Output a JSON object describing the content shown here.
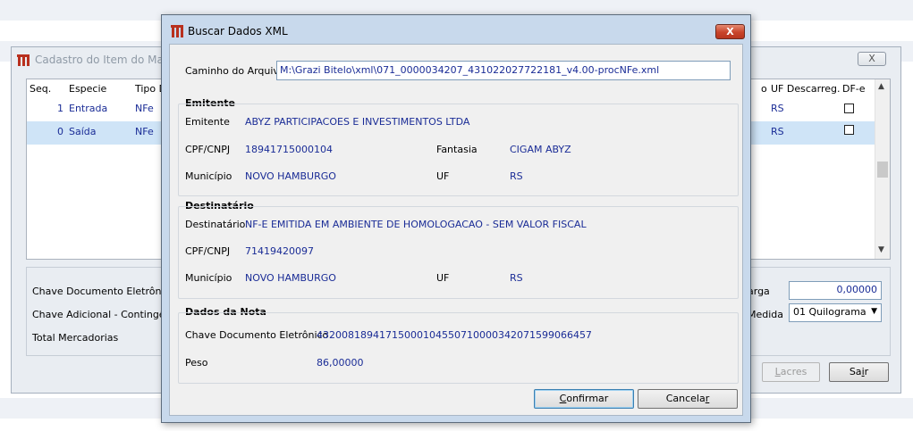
{
  "background_window": {
    "title": "Cadastro do Item do Manif",
    "close_label": "X",
    "columns_left": [
      "Seq.",
      "Especie",
      "Tipo D"
    ],
    "columns_right": [
      "o",
      "UF Descarreg.",
      "DF-e"
    ],
    "rows": [
      {
        "seq": "1",
        "especie": "Entrada",
        "tipo": "NFe",
        "uf": "RS"
      },
      {
        "seq": "0",
        "especie": "Saída",
        "tipo": "NFe",
        "uf": "RS"
      }
    ],
    "labels": {
      "chave_doc": "Chave Documento Eletrônico",
      "chave_adic": "Chave Adicional - Contingênci",
      "total_merc": "Total Mercadorias",
      "carga": "arga",
      "medida": "Medida"
    },
    "carga_value": "0,00000",
    "medida_value": "01 Quilograma",
    "buttons": {
      "lacres_prefix": "",
      "lacres_u": "L",
      "lacres_rest": "acres",
      "sair_prefix": "Sa",
      "sair_u": "i",
      "sair_rest": "r"
    }
  },
  "dialog": {
    "title": "Buscar Dados XML",
    "close_label": "X",
    "caminho_label": "Caminho do Arquivo",
    "caminho_value": "M:\\Grazi Bitelo\\xml\\071_0000034207_431022027722181_v4.00-procNFe.xml",
    "emitente": {
      "section": "Emitente",
      "emitente_label": "Emitente",
      "emitente_value": "ABYZ PARTICIPACOES E INVESTIMENTOS LTDA",
      "cpf_label": "CPF/CNPJ",
      "cpf_value": "18941715000104",
      "fantasia_label": "Fantasia",
      "fantasia_value": "CIGAM ABYZ",
      "municipio_label": "Município",
      "municipio_value": "NOVO HAMBURGO",
      "uf_label": "UF",
      "uf_value": "RS"
    },
    "destinatario": {
      "section": "Destinatário",
      "dest_label": "Destinatário",
      "dest_value": "NF-E EMITIDA EM AMBIENTE DE HOMOLOGACAO - SEM VALOR FISCAL",
      "cpf_label": "CPF/CNPJ",
      "cpf_value": "71419420097",
      "municipio_label": "Município",
      "municipio_value": "NOVO HAMBURGO",
      "uf_label": "UF",
      "uf_value": "RS"
    },
    "nota": {
      "section": "Dados da Nota",
      "chave_label": "Chave Documento Eletrônico",
      "chave_value": "43200818941715000104550710000342071599066457",
      "peso_label": "Peso",
      "peso_value": "86,00000"
    },
    "buttons": {
      "confirmar_u": "C",
      "confirmar_rest": "onfirmar",
      "cancelar_prefix": "Cancela",
      "cancelar_u": "r"
    }
  }
}
